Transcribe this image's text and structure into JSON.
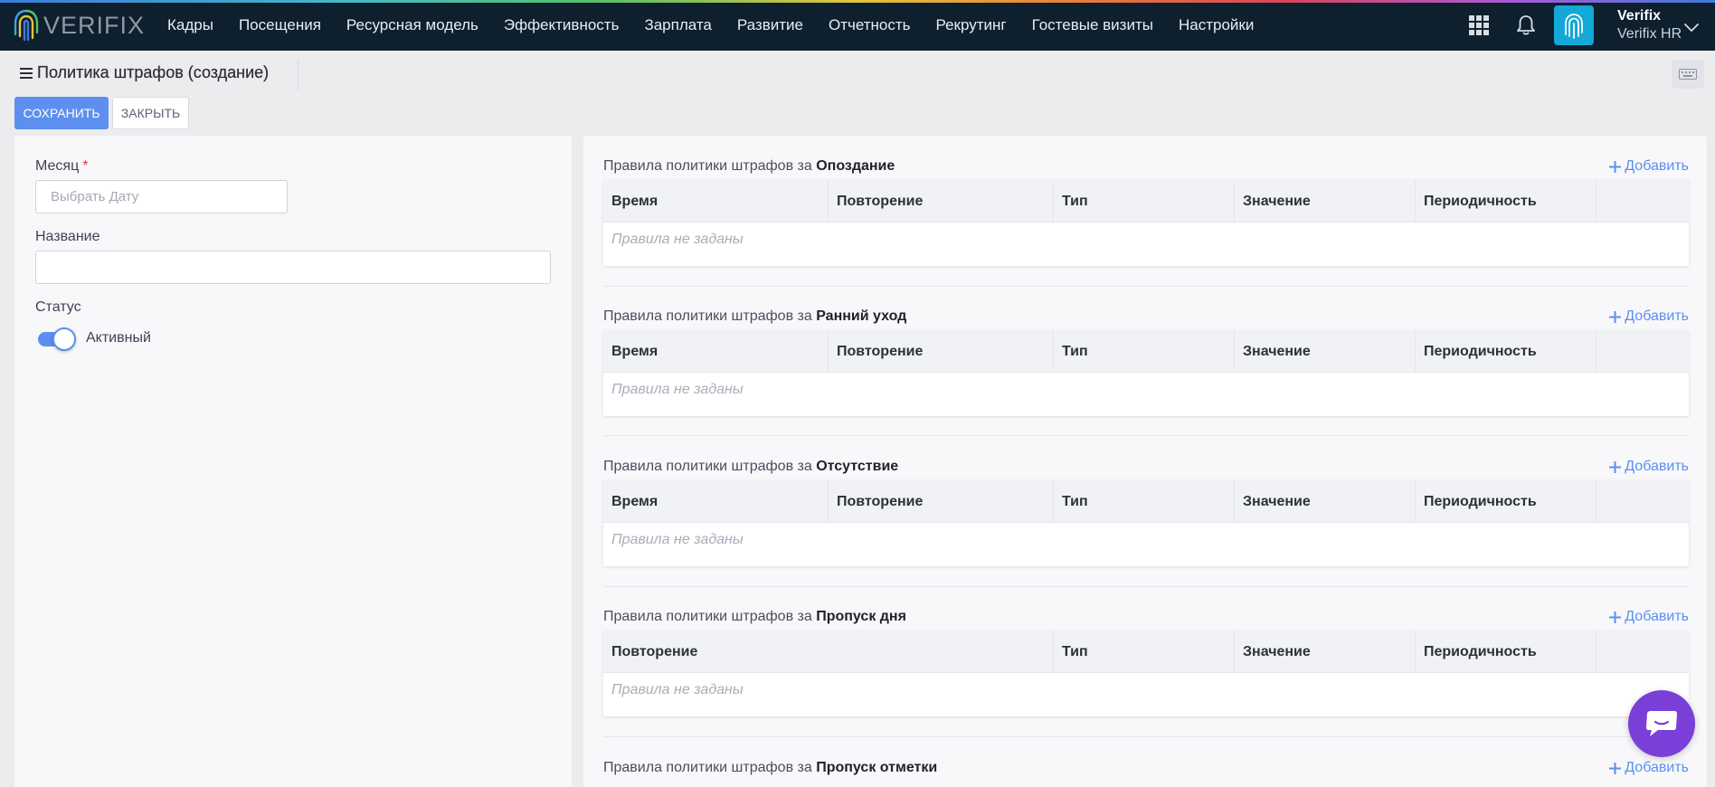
{
  "app": {
    "logo_text": "VERIFIX",
    "nav": [
      "Кадры",
      "Посещения",
      "Ресурсная модель",
      "Эффективность",
      "Зарплата",
      "Развитие",
      "Отчетность",
      "Рекрутинг",
      "Гостевые визиты",
      "Настройки"
    ],
    "user": {
      "name": "Verifix",
      "org": "Verifix HR"
    },
    "icons": [
      "apps-grid-icon",
      "bell-icon",
      "fingerprint-icon",
      "chevron-down-icon"
    ]
  },
  "page": {
    "title": "Политика штрафов (создание)",
    "save_label": "Сохранить",
    "close_label": "Закрыть"
  },
  "form": {
    "month_label": "Месяц",
    "required_mark": "*",
    "month_placeholder": "Выбрать Дату",
    "name_label": "Название",
    "name_value": "",
    "status_label": "Статус",
    "status_value": "Активный",
    "status_on": true
  },
  "rules": {
    "prefix": "Правила политики штрафов за",
    "add_label": "Добавить",
    "empty_text": "Правила не заданы",
    "sections": [
      {
        "name": "Опоздание",
        "columns": [
          "Время",
          "Повторение",
          "Тип",
          "Значение",
          "Периодичность"
        ]
      },
      {
        "name": "Ранний уход",
        "columns": [
          "Время",
          "Повторение",
          "Тип",
          "Значение",
          "Периодичность"
        ]
      },
      {
        "name": "Отсутствие",
        "columns": [
          "Время",
          "Повторение",
          "Тип",
          "Значение",
          "Периодичность"
        ]
      },
      {
        "name": "Пропуск дня",
        "columns": [
          "Повторение",
          "Тип",
          "Значение",
          "Периодичность"
        ]
      },
      {
        "name": "Пропуск отметки",
        "columns": []
      }
    ]
  },
  "colors": {
    "topbar": "#0e1f2d",
    "accent": "#5c8ff0",
    "chat": "#7a3fd9",
    "required": "#e3343f"
  }
}
